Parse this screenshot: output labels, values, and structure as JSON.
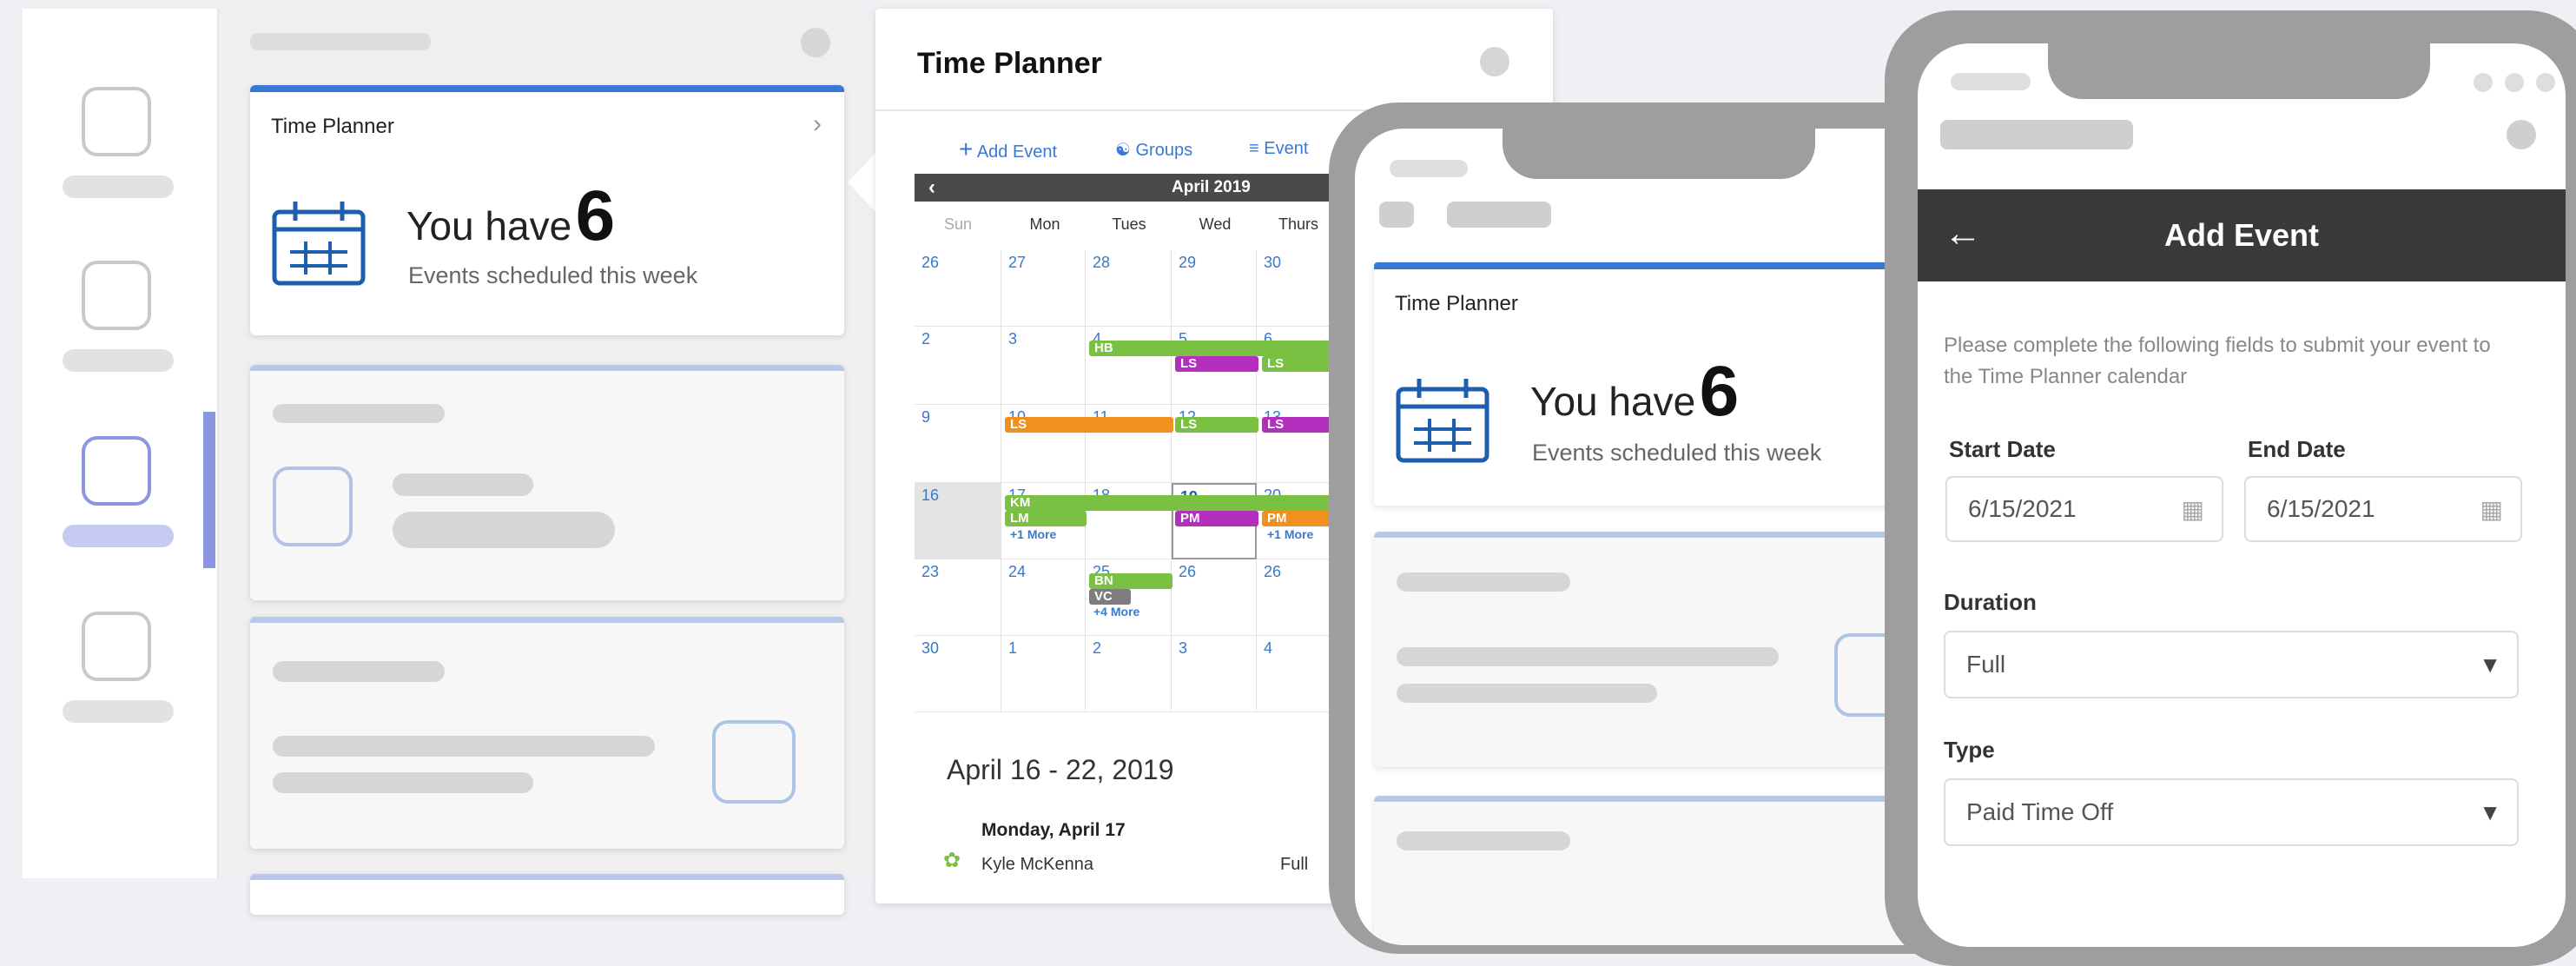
{
  "colors": {
    "accent_blue": "#3a78d6",
    "nav_active": "#8c96e0",
    "green": "#7ac043",
    "magenta": "#b52fbf",
    "orange": "#f0901e",
    "gray_event": "#7d7d7d"
  },
  "desktop_card": {
    "title": "Time Planner",
    "you_have": "You have",
    "count": "6",
    "subtitle": "Events scheduled this week",
    "chevron": "chevron-right-icon"
  },
  "calendar_panel": {
    "title": "Time Planner",
    "toolbar": {
      "add_event": "Add Event",
      "groups": "Groups",
      "event_filter": "Event"
    },
    "month": "April 2019",
    "days": [
      "Sun",
      "Mon",
      "Tues",
      "Wed",
      "Thurs"
    ],
    "weeks": [
      [
        "26",
        "27",
        "28",
        "29",
        "30"
      ],
      [
        "2",
        "3",
        "4",
        "5",
        "6"
      ],
      [
        "9",
        "10",
        "11",
        "12",
        "13"
      ],
      [
        "16",
        "17",
        "18",
        "19",
        "20"
      ],
      [
        "23",
        "24",
        "25",
        "26",
        "26"
      ],
      [
        "30",
        "1",
        "2",
        "3",
        "4"
      ]
    ],
    "events": {
      "hb": "HB",
      "ls_a": "LS",
      "ls_b": "LS",
      "ls_c": "LS",
      "ls_d": "LS",
      "ls_e": "LS",
      "km": "KM",
      "lm": "LM",
      "more_1": "+1 More",
      "pm_a": "PM",
      "pm_b": "PM",
      "more_2": "+1 More",
      "bn": "BN",
      "vc": "VC",
      "more_3": "+4 More"
    },
    "range_title": "April 16 - 22, 2019",
    "day_heading": "Monday, April 17",
    "entry_name": "Kyle McKenna",
    "entry_duration": "Full"
  },
  "phone_card": {
    "title": "Time Planner",
    "you_have": "You have",
    "count": "6",
    "subtitle": "Events scheduled this week"
  },
  "add_event": {
    "title": "Add Event",
    "intro": "Please complete the following fields to submit your event to the Time Planner calendar",
    "start_label": "Start Date",
    "start_value": "6/15/2021",
    "end_label": "End Date",
    "end_value": "6/15/2021",
    "duration_label": "Duration",
    "duration_value": "Full",
    "type_label": "Type",
    "type_value": "Paid Time Off"
  }
}
